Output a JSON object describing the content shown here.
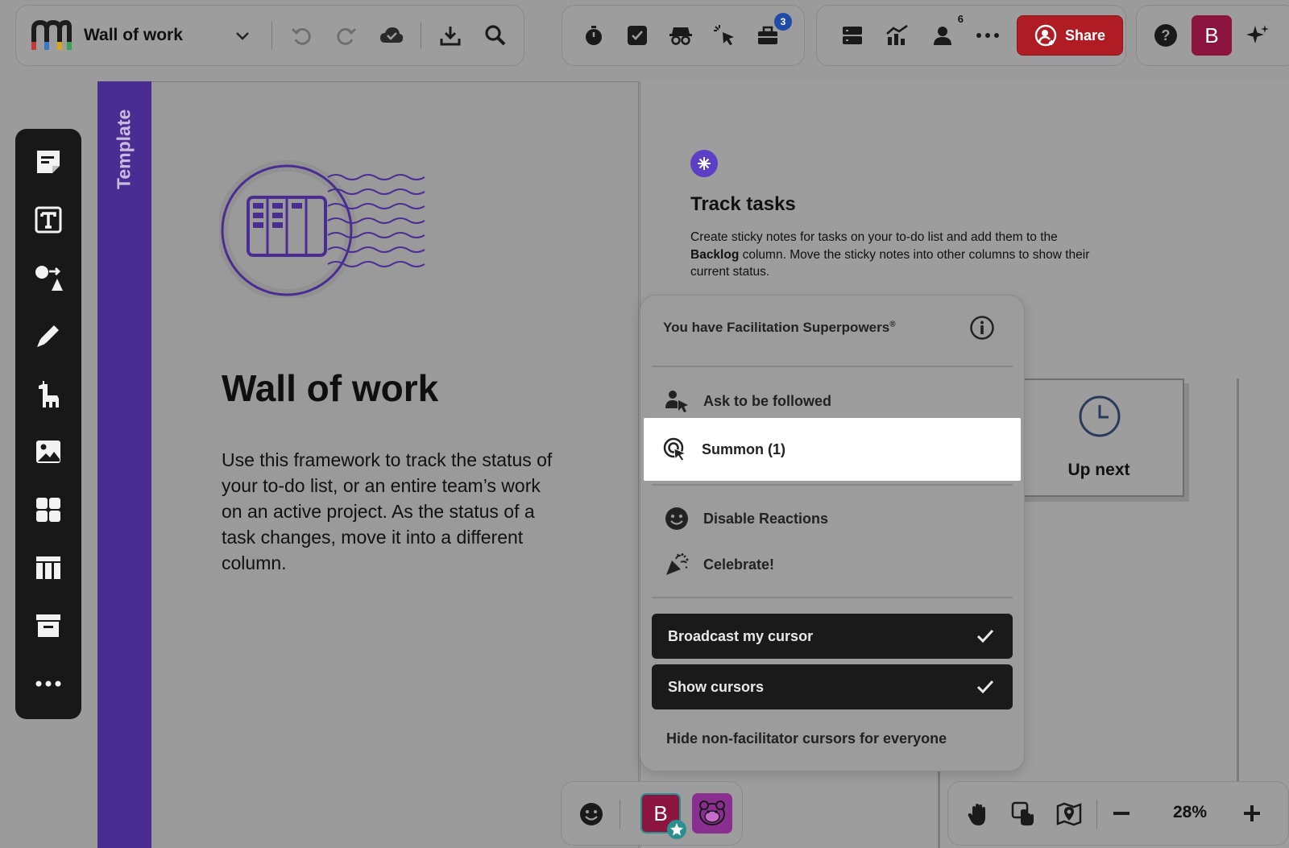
{
  "topbar": {
    "board_title": "Wall of work",
    "share_label": "Share",
    "user_initial": "B",
    "toolbox_badge": "3",
    "participants_count": "6"
  },
  "canvas": {
    "template_label": "Template",
    "title": "Wall of work",
    "description": "Use this framework to track the status of your to-do list, or an entire team’s work on an active project. As the status of a task changes, move it into a different column.",
    "track": {
      "title": "Track tasks",
      "desc_part1": "Create sticky notes for tasks on your to-do list and add them to the ",
      "desc_bold": "Backlog",
      "desc_part2": " column. Move the sticky notes into other columns to show their current status."
    },
    "up_next": "Up next"
  },
  "popup": {
    "heading": "You have Facilitation Superpowers",
    "heading_mark": "®",
    "items": [
      {
        "label": "Ask to be followed"
      },
      {
        "label": "Summon (1)"
      },
      {
        "label": "Disable Reactions"
      },
      {
        "label": "Celebrate!"
      }
    ],
    "toggles": [
      {
        "label": "Broadcast my cursor",
        "checked": true
      },
      {
        "label": "Show cursors",
        "checked": true
      }
    ],
    "hide_label": "Hide non-facilitator cursors for everyone"
  },
  "bottom": {
    "user_initial": "B",
    "zoom": "28%"
  },
  "colors": {
    "brand_purple": "#4a2d93",
    "share_red": "#b01c24",
    "avatar_maroon": "#8c1540",
    "accent_purple": "#5b3fc4"
  }
}
